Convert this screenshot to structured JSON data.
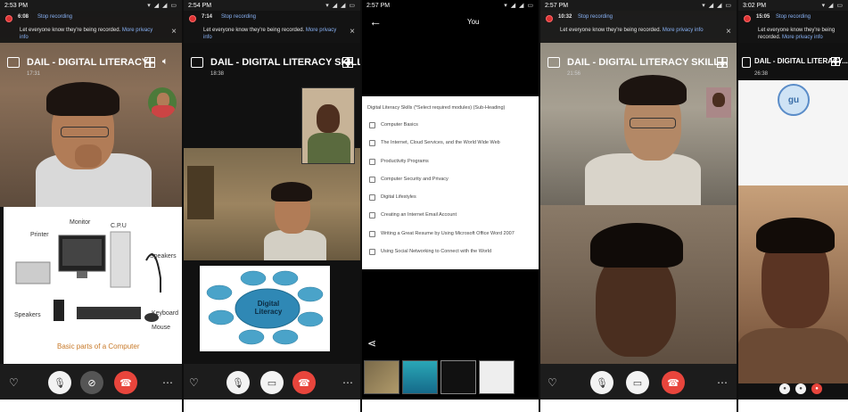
{
  "panels": [
    {
      "status_time": "2:53 PM",
      "rec_time": "6:08",
      "meeting_title": "DAIL - DIGITAL LITERACY",
      "meeting_duration": "17:31",
      "diagram_labels": [
        "Monitor",
        "C.P.U",
        "Printer",
        "Speakers",
        "Speakers",
        "Keyboard",
        "Mouse"
      ],
      "diagram_caption": "Basic parts of a Computer"
    },
    {
      "status_time": "2:54 PM",
      "rec_time": "7:14",
      "meeting_title": "DAIL - DIGITAL LITERACY SKILL...",
      "meeting_duration": "18:38",
      "diagram_center": "Digital Literacy"
    },
    {
      "status_time": "2:57 PM",
      "header_title": "You",
      "form_heading": "Digital Literacy Skills (*Select required modules) (Sub-Heading)",
      "form_items": [
        "Computer Basics",
        "The Internet, Cloud Services, and the World Wide Web",
        "Productivity Programs",
        "Computer Security and Privacy",
        "Digital Lifestyles",
        "Creating an Internet Email Account",
        "Writing a Great Resume by Using Microsoft Office Word 2007",
        "Using Social Networking to Connect with the World"
      ]
    },
    {
      "status_time": "2:57 PM",
      "rec_time": "10:32",
      "meeting_title": "DAIL - DIGITAL LITERACY SKILL...",
      "meeting_duration": "21:56"
    },
    {
      "status_time": "3:02 PM",
      "rec_time": "15:05",
      "meeting_title": "DAIL - DIGITAL LITERACY...",
      "meeting_duration": "26:38",
      "avatar_initials": "gu"
    }
  ],
  "recording": {
    "stop_label": "Stop recording",
    "message": "Let everyone know they're being recorded.",
    "link": "More privacy info"
  },
  "icons": {
    "chat": "chat-icon",
    "grid": "grid-icon",
    "speaker": "speaker-icon",
    "mic": "mic-icon",
    "camera": "camera-icon",
    "end_call": "end-call-icon",
    "heart": "heart-icon",
    "more": "more-icon",
    "share": "share-icon",
    "back": "back-arrow-icon"
  },
  "colors": {
    "end_call": "#e8453c",
    "link": "#8ab4f8",
    "diagram_bubble": "#4aa3c9"
  }
}
